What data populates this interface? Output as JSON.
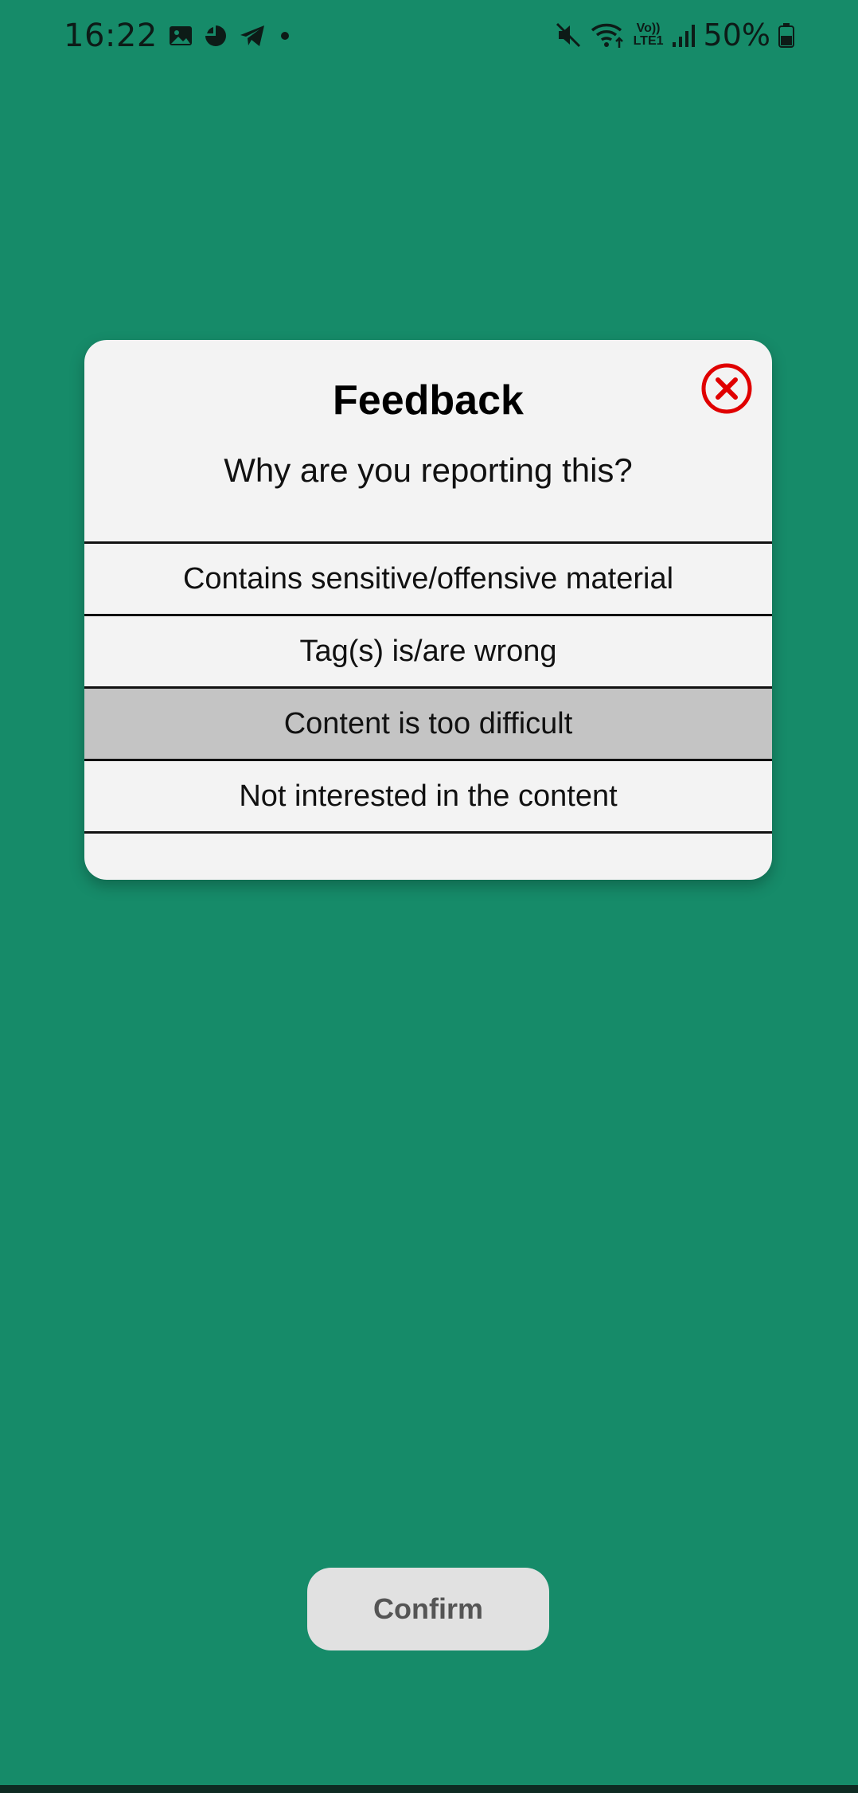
{
  "status_bar": {
    "time": "16:22",
    "left_icons": [
      "image-icon",
      "app-icon",
      "telegram-icon",
      "dot-icon"
    ],
    "right_icons": [
      "mute-icon",
      "wifi-icon",
      "volte-icon",
      "signal-icon",
      "battery-icon"
    ],
    "volte_top": "Vo))",
    "volte_bottom": "LTE1",
    "battery": "50%"
  },
  "dialog": {
    "title": "Feedback",
    "subtitle": "Why are you reporting this?",
    "close_icon": "close-circle-icon",
    "close_color": "#e00000",
    "options": [
      {
        "label": "Contains sensitive/offensive material",
        "selected": false
      },
      {
        "label": "Tag(s) is/are wrong",
        "selected": false
      },
      {
        "label": "Content is too difficult",
        "selected": true
      },
      {
        "label": "Not interested in the content",
        "selected": false
      }
    ]
  },
  "confirm": {
    "label": "Confirm"
  },
  "colors": {
    "background": "#168b69",
    "dialog": "#f3f3f3",
    "selected_option": "#c4c4c4",
    "confirm_button": "#e1e1e1"
  }
}
